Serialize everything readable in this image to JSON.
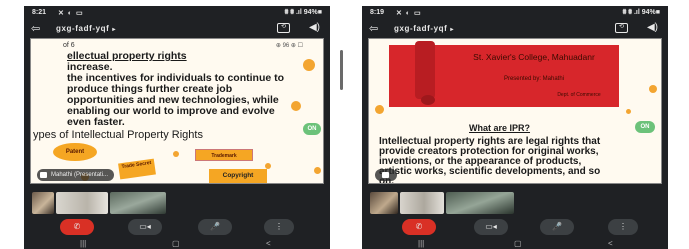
{
  "left": {
    "status": {
      "time": "8:21",
      "status_icons": "✕ ◐ ▭",
      "right_icons": "⩩ ⩩ .ıl 94%■"
    },
    "call": {
      "back": "⇦",
      "meeting_code": "gxg-fadf-yqf",
      "code_chevron": "▸",
      "camera_switch": "⟲",
      "volume": "◀)"
    },
    "slide": {
      "pager": "of 6",
      "zoom_tag": "⊕ 96 ⊕ ☐",
      "para_line1_underline": "ellectual property rights",
      "para_line2": "increase.",
      "para_rest": "the incentives for individuals to continue to produce things further create job opportunities and new technologies, while enabling our world to improve and evolve even faster.",
      "heading": "ypes of Intellectual Property Rights",
      "shapes": {
        "patent": "Patent",
        "trademark": "Trademark",
        "trade_secret": "Trade Secret",
        "copyright": "Copyright"
      },
      "badge": "ON",
      "caption": "Mahathi (Presentati..."
    }
  },
  "right": {
    "status": {
      "time": "8:19",
      "status_icons": "✕ ◐ ▭",
      "right_icons": "⩩ ⩩ .ıl 94%■"
    },
    "call": {
      "back": "⇦",
      "meeting_code": "gxg-fadf-yqf",
      "code_chevron": "▸",
      "camera_switch": "⟲",
      "volume": "◀)"
    },
    "slide": {
      "banner_title": "St. Xavier's College, Mahuadanr",
      "banner_subtitle": "Presented by: Mahathi",
      "banner_small": "Dept. of Commerce",
      "heading": "What are IPR?",
      "para": "Intellectual property rights are legal rights that provide creators protection for original works, inventions, or the appearance of products, artistic works, scientific developments, and so on.",
      "badge": "ON"
    }
  },
  "controls": {
    "end_call": "✆",
    "camera": "▭◂",
    "mic": "🎤",
    "more": "⋮"
  },
  "navbar": {
    "recents": "|||",
    "home": "▢",
    "back": "<"
  },
  "colors": {
    "accent_orange": "#f5a623",
    "end_call_red": "#d93025",
    "banner_red": "#d7262b",
    "phone_bg": "#1f2124"
  }
}
